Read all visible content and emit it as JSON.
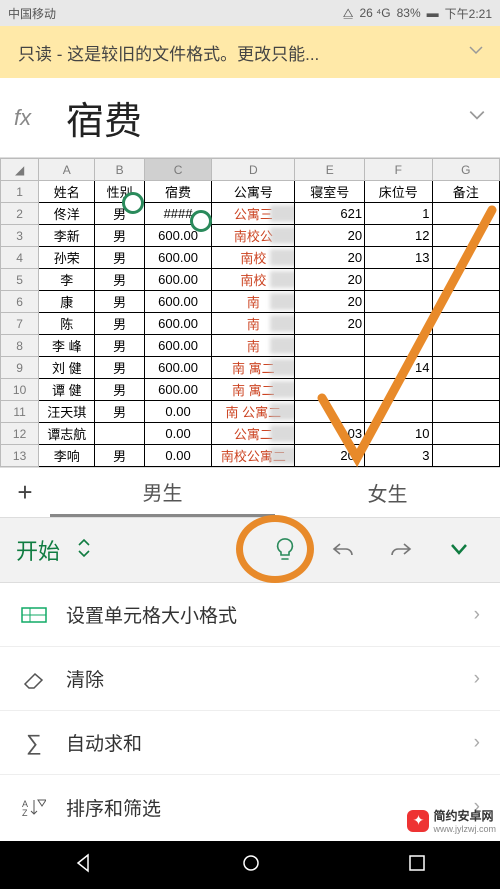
{
  "status": {
    "carrier": "中国移动",
    "signal": "26 ⁴G",
    "battery": "83%",
    "time": "下午2:21"
  },
  "banner": {
    "text": "只读 - 这是较旧的文件格式。更改只能..."
  },
  "formula": {
    "fx": "fx",
    "value": "宿费"
  },
  "columns": [
    "A",
    "B",
    "C",
    "D",
    "E",
    "F",
    "G"
  ],
  "headers": {
    "name": "姓名",
    "sex": "性别",
    "fee": "宿费",
    "apt": "公寓号",
    "room": "寝室号",
    "bed": "床位号",
    "note": "备注"
  },
  "rows": [
    {
      "n": "佟洋",
      "s": "男",
      "f": "####",
      "a": "公寓三",
      "r": "621",
      "b": "1",
      "note": ""
    },
    {
      "n": "李新",
      "s": "男",
      "f": "600.00",
      "a": "南校公",
      "r": "20",
      "b": "12",
      "note": ""
    },
    {
      "n": "孙荣",
      "s": "男",
      "f": "600.00",
      "a": "南校",
      "r": "20",
      "b": "13",
      "note": ""
    },
    {
      "n": "李",
      "s": "男",
      "f": "600.00",
      "a": "南校",
      "r": "20",
      "b": "",
      "note": ""
    },
    {
      "n": "康",
      "s": "男",
      "f": "600.00",
      "a": "南",
      "r": "20",
      "b": "",
      "note": ""
    },
    {
      "n": "陈",
      "s": "男",
      "f": "600.00",
      "a": "南",
      "r": "20",
      "b": "",
      "note": ""
    },
    {
      "n": "李   峰",
      "s": "男",
      "f": "600.00",
      "a": "南",
      "r": "",
      "b": "",
      "note": ""
    },
    {
      "n": "刘   健",
      "s": "男",
      "f": "600.00",
      "a": "南   寓二",
      "r": "",
      "b": "14",
      "note": ""
    },
    {
      "n": "谭  健",
      "s": "男",
      "f": "600.00",
      "a": "南   寓二",
      "r": "",
      "b": "",
      "note": ""
    },
    {
      "n": "汪天琪",
      "s": "男",
      "f": "0.00",
      "a": "南  公寓二",
      "r": "",
      "b": "",
      "note": ""
    },
    {
      "n": "谭志航",
      "s": "",
      "f": "0.00",
      "a": "    公寓二",
      "r": "03",
      "b": "10",
      "note": ""
    },
    {
      "n": "李响",
      "s": "男",
      "f": "0.00",
      "a": "南校公寓二",
      "r": "203",
      "b": "3",
      "note": ""
    }
  ],
  "tabs": {
    "t1": "男生",
    "t2": "女生"
  },
  "toolbar": {
    "start": "开始"
  },
  "menu": {
    "m1": "设置单元格大小格式",
    "m2": "清除",
    "m3": "自动求和",
    "m4": "排序和筛选"
  },
  "watermark": {
    "text": "简约安卓网",
    "url": "www.jylzwj.com"
  },
  "chart_data": null
}
